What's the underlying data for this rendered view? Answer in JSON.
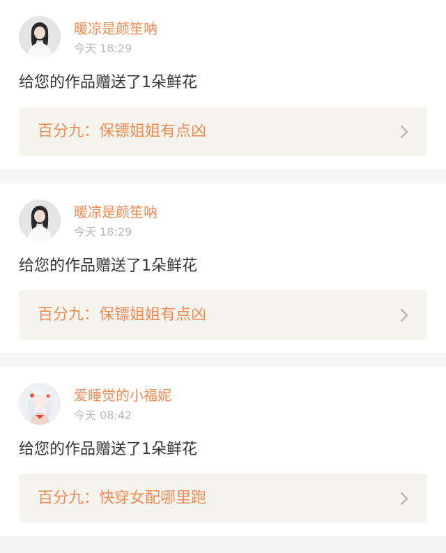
{
  "notifications": [
    {
      "user": "暖凉是颜笙呐",
      "time": "今天 18:29",
      "message": "给您的作品赠送了1朵鲜花",
      "work": "百分九：保镖姐姐有点凶",
      "avatar_icon": "user-avatar"
    },
    {
      "user": "暖凉是颜笙呐",
      "time": "今天 18:29",
      "message": "给您的作品赠送了1朵鲜花",
      "work": "百分九：保镖姐姐有点凶",
      "avatar_icon": "user-avatar"
    },
    {
      "user": "爱睡觉的小福妮",
      "time": "今天 08:42",
      "message": "给您的作品赠送了1朵鲜花",
      "work": "百分九：快穿女配哪里跑",
      "avatar_icon": "user-avatar"
    }
  ],
  "colors": {
    "accent": "#ef8c55",
    "text": "#333333",
    "muted": "#b8b8b8",
    "link_bg": "#f5f4ef",
    "page_bg": "#f5f5f5"
  }
}
